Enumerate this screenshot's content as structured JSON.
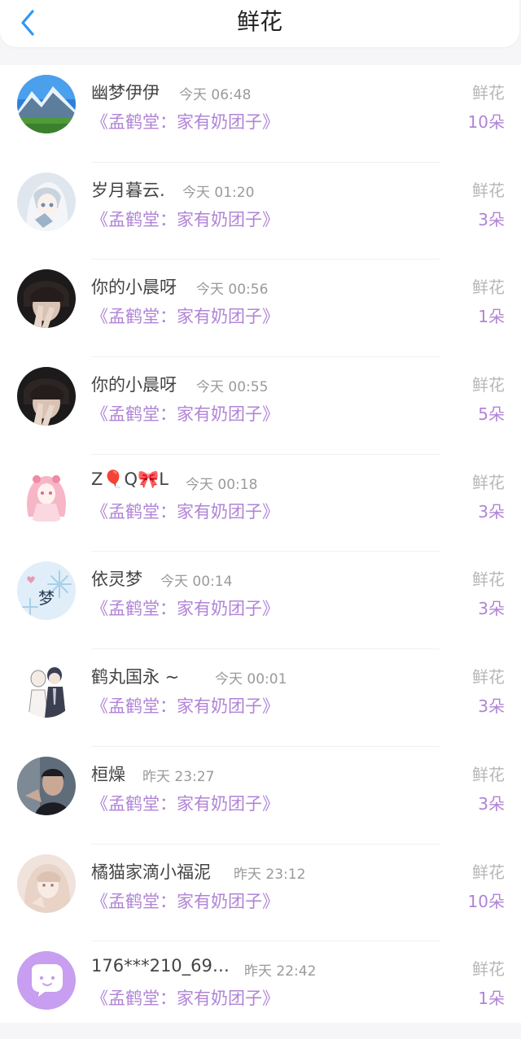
{
  "header": {
    "title": "鲜花",
    "back_icon": "chevron-left-icon",
    "accent_color": "#2f97f3"
  },
  "colors": {
    "book_purple": "#b084d6",
    "time_gray": "#9a9a9a",
    "name_text": "#444444"
  },
  "rows": [
    {
      "name": "幽梦伊伊",
      "time": "今天 06:48",
      "book": "《孟鹤堂：家有奶团子》",
      "gift": "鲜花",
      "count": "10朵",
      "avatar": "mountain-landscape"
    },
    {
      "name": "岁月暮云.",
      "time": "今天 01:20",
      "book": "《孟鹤堂：家有奶团子》",
      "gift": "鲜花",
      "count": "3朵",
      "avatar": "anime-girl-white-hair"
    },
    {
      "name": "你的小晨呀",
      "time": "今天 00:56",
      "book": "《孟鹤堂：家有奶团子》",
      "gift": "鲜花",
      "count": "1朵",
      "avatar": "person-peace-sign"
    },
    {
      "name": "你的小晨呀",
      "time": "今天 00:55",
      "book": "《孟鹤堂：家有奶团子》",
      "gift": "鲜花",
      "count": "5朵",
      "avatar": "person-peace-sign"
    },
    {
      "name": "Z🎈Q🎀L",
      "time": "今天 00:18",
      "book": "《孟鹤堂：家有奶团子》",
      "gift": "鲜花",
      "count": "3朵",
      "avatar": "anime-girl-pink-hair"
    },
    {
      "name": "依灵梦",
      "time": "今天 00:14",
      "book": "《孟鹤堂：家有奶团子》",
      "gift": "鲜花",
      "count": "3朵",
      "avatar": "snowflake-dream"
    },
    {
      "name": "鹤丸国永 ~",
      "time": "今天 00:01",
      "book": "《孟鹤堂：家有奶团子》",
      "gift": "鲜花",
      "count": "3朵",
      "avatar": "anime-sketch-pair"
    },
    {
      "name": "桓燥",
      "time": "昨天 23:27",
      "book": "《孟鹤堂：家有奶团子》",
      "gift": "鲜花",
      "count": "3朵",
      "avatar": "man-dark-photo"
    },
    {
      "name": "橘猫家滴小福泥",
      "time": "昨天 23:12",
      "book": "《孟鹤堂：家有奶团子》",
      "gift": "鲜花",
      "count": "10朵",
      "avatar": "soft-portrait"
    },
    {
      "name": "176***210_69…",
      "time": "昨天 22:42",
      "book": "《孟鹤堂：家有奶团子》",
      "gift": "鲜花",
      "count": "1朵",
      "avatar": "default-chat-bubble"
    }
  ]
}
